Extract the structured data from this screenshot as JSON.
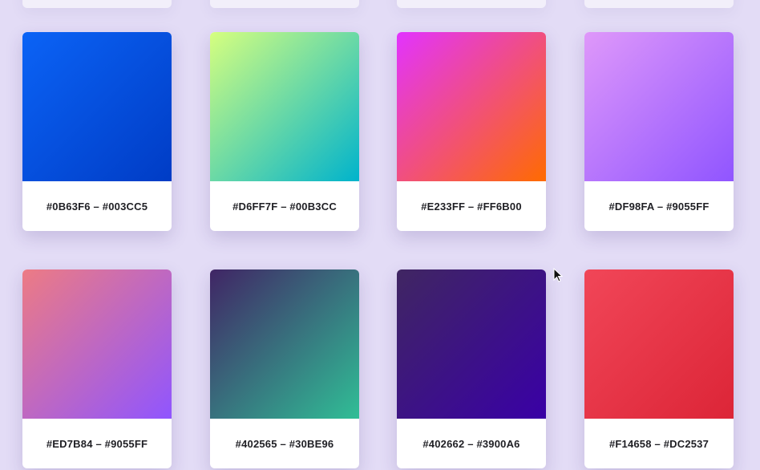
{
  "cards": [
    {
      "label": "#0B63F6 – #003CC5",
      "from": "#0B63F6",
      "to": "#003CC5"
    },
    {
      "label": "#D6FF7F – #00B3CC",
      "from": "#D6FF7F",
      "to": "#00B3CC"
    },
    {
      "label": "#E233FF – #FF6B00",
      "from": "#E233FF",
      "to": "#FF6B00"
    },
    {
      "label": "#DF98FA – #9055FF",
      "from": "#DF98FA",
      "to": "#9055FF"
    },
    {
      "label": "#ED7B84 – #9055FF",
      "from": "#ED7B84",
      "to": "#9055FF"
    },
    {
      "label": "#402565 – #30BE96",
      "from": "#402565",
      "to": "#30BE96"
    },
    {
      "label": "#402662 – #3900A6",
      "from": "#402662",
      "to": "#3900A6"
    },
    {
      "label": "#F14658 – #DC2537",
      "from": "#F14658",
      "to": "#DC2537"
    }
  ],
  "colors": {
    "background": "#e3dcf6",
    "card": "#ffffff",
    "caption_text": "#1f1f24"
  },
  "icons": {
    "cursor": "mouse-pointer-icon"
  }
}
